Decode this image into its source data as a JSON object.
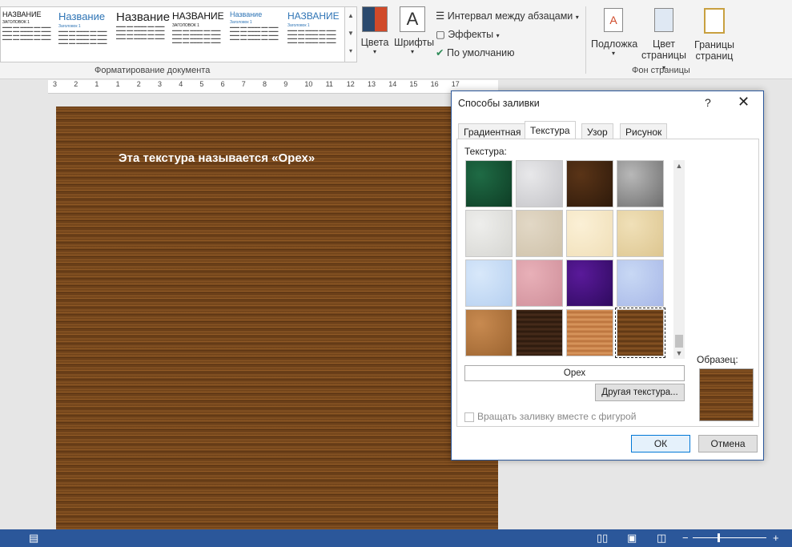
{
  "ribbon": {
    "style_gallery": [
      {
        "heading": "НАЗВАНИЕ",
        "sub": "ЗАГОЛОВОК 1",
        "color": "#111111"
      },
      {
        "heading": "Название",
        "sub": "Заголовок 1",
        "color": "#2e74b5"
      },
      {
        "heading": "Название",
        "sub": "",
        "color": "#222222"
      },
      {
        "heading": "НАЗВАНИЕ",
        "sub": "ЗАГОЛОВОК 1",
        "color": "#111111"
      },
      {
        "heading": "Название",
        "sub": "Заголовок 1",
        "color": "#2e74b5"
      },
      {
        "heading": "НАЗВАНИЕ",
        "sub": "Заголовок 1",
        "color": "#2e74b5"
      }
    ],
    "group_document_formatting": "Форматирование документа",
    "colors": "Цвета",
    "fonts": "Шрифты",
    "paragraph_spacing": "Интервал между абзацами",
    "effects": "Эффекты",
    "set_default": "По умолчанию",
    "watermark": "Подложка",
    "page_color": [
      "Цвет",
      "страницы"
    ],
    "page_borders": [
      "Границы",
      "страниц"
    ],
    "group_page_background": "Фон страницы"
  },
  "ruler": {
    "ticks": [
      "3",
      "2",
      "1",
      "1",
      "2",
      "3",
      "4",
      "5",
      "6",
      "7",
      "8",
      "9",
      "10",
      "11",
      "12",
      "13",
      "14",
      "15",
      "16",
      "17"
    ]
  },
  "document": {
    "text": "Эта текстура называется «Орех»"
  },
  "dialog": {
    "title": "Способы заливки",
    "help": "?",
    "close": "✕",
    "tabs": [
      "Градиентная",
      "Текстура",
      "Узор",
      "Рисунок"
    ],
    "active_tab": "Текстура",
    "texture_label": "Текстура:",
    "textures": [
      {
        "name": "green-marble",
        "c1": "#1f6b45",
        "c2": "#0e3d25"
      },
      {
        "name": "white-marble",
        "c1": "#e8e8ea",
        "c2": "#c4c4c8"
      },
      {
        "name": "brown-marble",
        "c1": "#5a3417",
        "c2": "#2e1a0b"
      },
      {
        "name": "granite",
        "c1": "#b8b8b8",
        "c2": "#6e6e6e"
      },
      {
        "name": "recycled-paper",
        "c1": "#eeeeec",
        "c2": "#d6d6d2"
      },
      {
        "name": "stationery",
        "c1": "#e2d8c6",
        "c2": "#cfc2aa"
      },
      {
        "name": "parchment",
        "c1": "#fbf0d6",
        "c2": "#f0dfb8"
      },
      {
        "name": "papyrus",
        "c1": "#f0e0b8",
        "c2": "#ddc690"
      },
      {
        "name": "blue-tissue",
        "c1": "#d8e8fa",
        "c2": "#b6d0f0"
      },
      {
        "name": "pink-tissue",
        "c1": "#e8b0b8",
        "c2": "#cf8f9a"
      },
      {
        "name": "purple-mesh",
        "c1": "#5a1a9a",
        "c2": "#2e0a5e"
      },
      {
        "name": "bouquet",
        "c1": "#c8d8f4",
        "c2": "#a8b8e8"
      },
      {
        "name": "cork",
        "c1": "#c88a50",
        "c2": "#9c6430"
      },
      {
        "name": "walnut-dark",
        "c1": "#4a2e1c",
        "c2": "#2a180c"
      },
      {
        "name": "oak",
        "c1": "#dc9a60",
        "c2": "#b8703a"
      },
      {
        "name": "walnut",
        "c1": "#8a5524",
        "c2": "#5a3412"
      }
    ],
    "selected_texture": "Орех",
    "other_texture_button": "Другая текстура...",
    "rotate_checkbox": "Вращать заливку вместе с фигурой",
    "sample_label": "Образец:",
    "ok": "ОК",
    "cancel": "Отмена"
  },
  "statusbar": {
    "bg": "#2b579a",
    "zoom_minus": "−",
    "zoom_plus": "+"
  }
}
